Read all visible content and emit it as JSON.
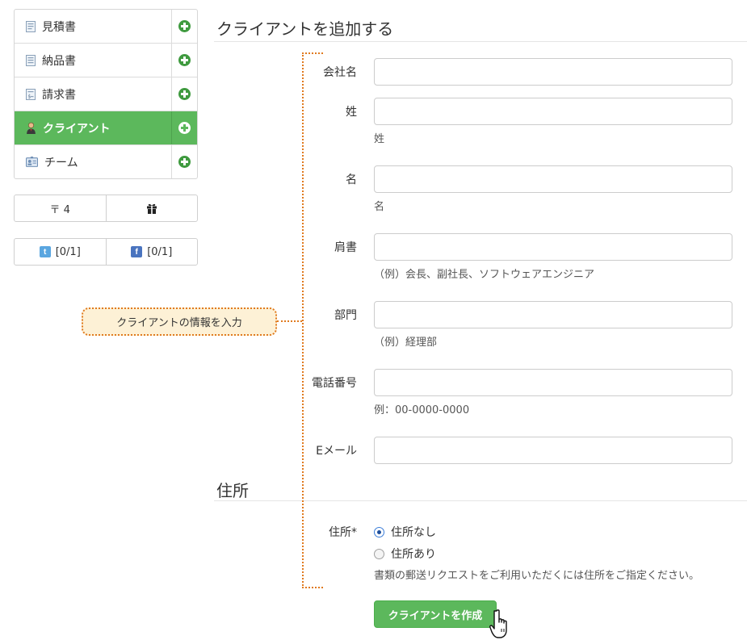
{
  "sidebar": {
    "items": [
      {
        "label": "見積書",
        "icon": "estimate-doc-icon",
        "active": false
      },
      {
        "label": "納品書",
        "icon": "delivery-doc-icon",
        "active": false
      },
      {
        "label": "請求書",
        "icon": "invoice-doc-icon",
        "active": false
      },
      {
        "label": "クライアント",
        "icon": "client-person-icon",
        "active": true
      },
      {
        "label": "チーム",
        "icon": "team-id-card-icon",
        "active": false
      }
    ],
    "postal_button": "〒 4",
    "gift_icon": "gift-icon",
    "twitter_count": "[0/1]",
    "facebook_count": "[0/1]",
    "twitter_glyph": "t",
    "facebook_glyph": "f"
  },
  "page": {
    "title": "クライアントを追加する",
    "address_section_title": "住所"
  },
  "form": {
    "company": {
      "label": "会社名",
      "value": ""
    },
    "last_name": {
      "label": "姓",
      "value": "",
      "help": "姓"
    },
    "first_name": {
      "label": "名",
      "value": "",
      "help": "名"
    },
    "position": {
      "label": "肩書",
      "value": "",
      "help": "（例）会長、副社長、ソフトウェアエンジニア"
    },
    "department": {
      "label": "部門",
      "value": "",
      "help": "（例）経理部"
    },
    "phone": {
      "label": "電話番号",
      "value": "",
      "help": "例：00-0000-0000"
    },
    "email": {
      "label": "Eメール",
      "value": ""
    },
    "address": {
      "label": "住所*",
      "options": [
        "住所なし",
        "住所あり"
      ],
      "selected": "住所なし",
      "help": "書類の郵送リクエストをご利用いただくには住所をご指定ください。"
    },
    "submit_label": "クライアントを作成"
  },
  "annotation": {
    "callout_text": "クライアントの情報を入力"
  },
  "colors": {
    "accent_green": "#5cb85c",
    "plus_green": "#3f9a3f",
    "annotation_orange": "#e07a1f",
    "annotation_fill": "#fdf1d6"
  }
}
